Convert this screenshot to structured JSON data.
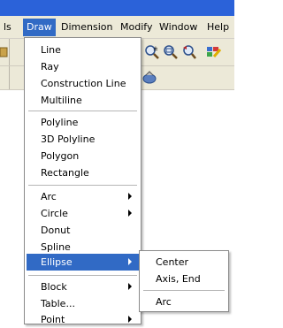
{
  "menubar": {
    "items": [
      {
        "label": "ls"
      },
      {
        "label": "Draw"
      },
      {
        "label": "Dimension"
      },
      {
        "label": "Modify"
      },
      {
        "label": "Window"
      },
      {
        "label": "Help"
      }
    ]
  },
  "toolbar": {
    "icons": [
      "zoom-realtime-icon",
      "zoom-window-icon",
      "zoom-previous-icon",
      "properties-icon",
      "pan-icon"
    ]
  },
  "draw_menu": {
    "groups": [
      [
        "Line",
        "Ray",
        "Construction Line",
        "Multiline"
      ],
      [
        "Polyline",
        "3D Polyline",
        "Polygon",
        "Rectangle"
      ],
      [
        "Arc",
        "Circle",
        "Donut",
        "Spline",
        "Ellipse"
      ],
      [
        "Block",
        "Table...",
        "Point"
      ]
    ],
    "submenu_items": [
      "Arc",
      "Circle",
      "Ellipse",
      "Block",
      "Point"
    ],
    "highlighted": "Ellipse"
  },
  "ellipse_submenu": {
    "items": [
      "Center",
      "Axis, End",
      "Arc"
    ]
  },
  "colors": {
    "highlight": "#316ac5",
    "menubar": "#ece9d8",
    "title": "#2b62d9"
  }
}
